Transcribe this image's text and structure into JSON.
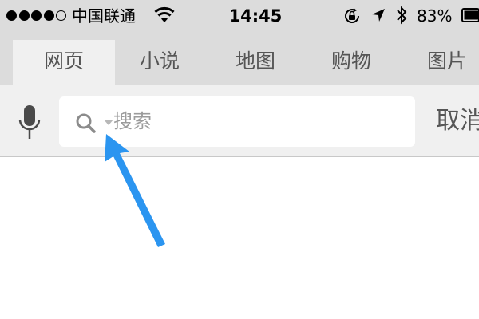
{
  "status_bar": {
    "signal_bars_filled": 4,
    "signal_bars_total": 5,
    "carrier": "中国联通",
    "time": "14:45",
    "battery_percent": "83%"
  },
  "tabs": [
    {
      "label": "网页",
      "active": true
    },
    {
      "label": "小说",
      "active": false
    },
    {
      "label": "地图",
      "active": false
    },
    {
      "label": "购物",
      "active": false
    },
    {
      "label": "图片",
      "active": false
    }
  ],
  "search": {
    "placeholder": "搜索",
    "value": ""
  },
  "cancel_label": "取消",
  "colors": {
    "chrome_bg": "#dcdcdc",
    "search_row_bg": "#f0f0f0",
    "annotation_arrow": "#2b95f0"
  },
  "icons": [
    "wifi-icon",
    "rotation-lock-icon",
    "location-arrow-icon",
    "bluetooth-icon",
    "battery-icon",
    "microphone-icon",
    "search-icon",
    "chevron-down-icon"
  ]
}
